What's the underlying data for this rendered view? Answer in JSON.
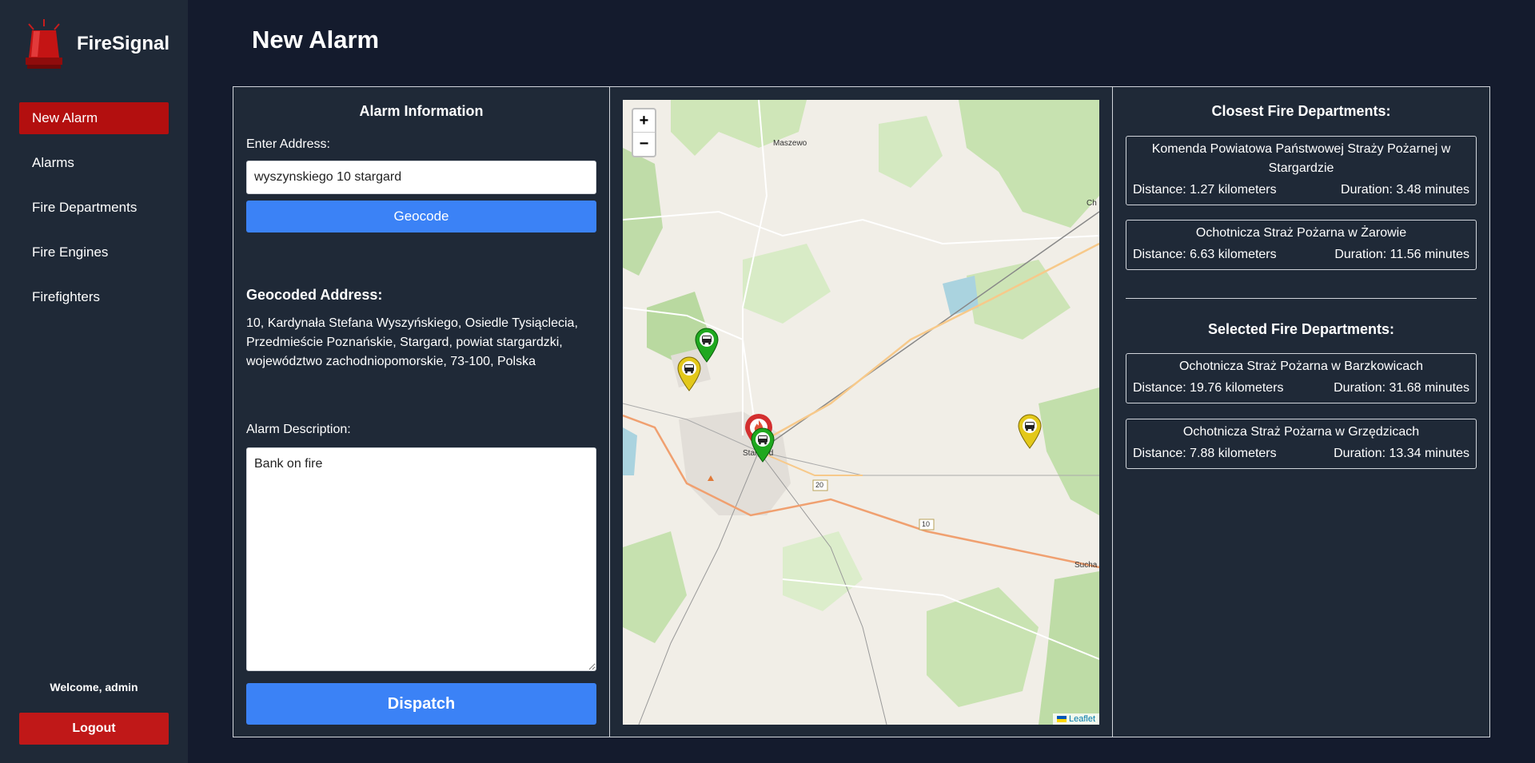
{
  "app": {
    "name": "FireSignal",
    "logo_icon": "siren-icon"
  },
  "sidebar": {
    "items": [
      {
        "label": "New Alarm",
        "active": true
      },
      {
        "label": "Alarms",
        "active": false
      },
      {
        "label": "Fire Departments",
        "active": false
      },
      {
        "label": "Fire Engines",
        "active": false
      },
      {
        "label": "Firefighters",
        "active": false
      }
    ],
    "welcome": "Welcome, admin",
    "logout_label": "Logout"
  },
  "header": {
    "title": "New Alarm"
  },
  "alarm_info": {
    "heading": "Alarm Information",
    "address_label": "Enter Address:",
    "address_value": "wyszynskiego 10 stargard",
    "geocode_label": "Geocode",
    "geocoded_heading": "Geocoded Address:",
    "geocoded_text": "10, Kardynała Stefana Wyszyńskiego, Osiedle Tysiąclecia, Przedmieście Poznańskie, Stargard, powiat stargardzki, województwo zachodniopomorskie, 73-100, Polska",
    "description_label": "Alarm Description:",
    "description_value": "Bank on fire",
    "dispatch_label": "Dispatch"
  },
  "map": {
    "zoom_in": "+",
    "zoom_out": "−",
    "attribution": "Leaflet",
    "places": {
      "maszewo": "Maszewo",
      "stargard": "Stargard",
      "ch": "Ch",
      "sucha": "Sucha",
      "road_20": "20",
      "road_10": "10"
    },
    "markers": [
      {
        "type": "fire",
        "color": "#d32f2f"
      },
      {
        "type": "selected-department",
        "color": "#1fa81f"
      },
      {
        "type": "selected-department",
        "color": "#1fa81f"
      },
      {
        "type": "department",
        "color": "#e3c81a"
      },
      {
        "type": "department",
        "color": "#e3c81a"
      }
    ]
  },
  "closest": {
    "heading": "Closest Fire Departments:",
    "departments": [
      {
        "name": "Komenda Powiatowa Państwowej Straży Pożarnej w Stargardzie",
        "distance": "Distance: 1.27 kilometers",
        "duration": "Duration: 3.48 minutes"
      },
      {
        "name": "Ochotnicza Straż Pożarna w Żarowie",
        "distance": "Distance: 6.63 kilometers",
        "duration": "Duration: 11.56 minutes"
      }
    ]
  },
  "selected": {
    "heading": "Selected Fire Departments:",
    "departments": [
      {
        "name": "Ochotnicza Straż Pożarna w Barzkowicach",
        "distance": "Distance: 19.76 kilometers",
        "duration": "Duration: 31.68 minutes"
      },
      {
        "name": "Ochotnicza Straż Pożarna w Grzędzicach",
        "distance": "Distance: 7.88 kilometers",
        "duration": "Duration: 13.34 minutes"
      }
    ]
  },
  "colors": {
    "background": "#141b2d",
    "panel": "#1f2937",
    "accent_red": "#b30f0f",
    "accent_blue": "#3b82f6"
  }
}
